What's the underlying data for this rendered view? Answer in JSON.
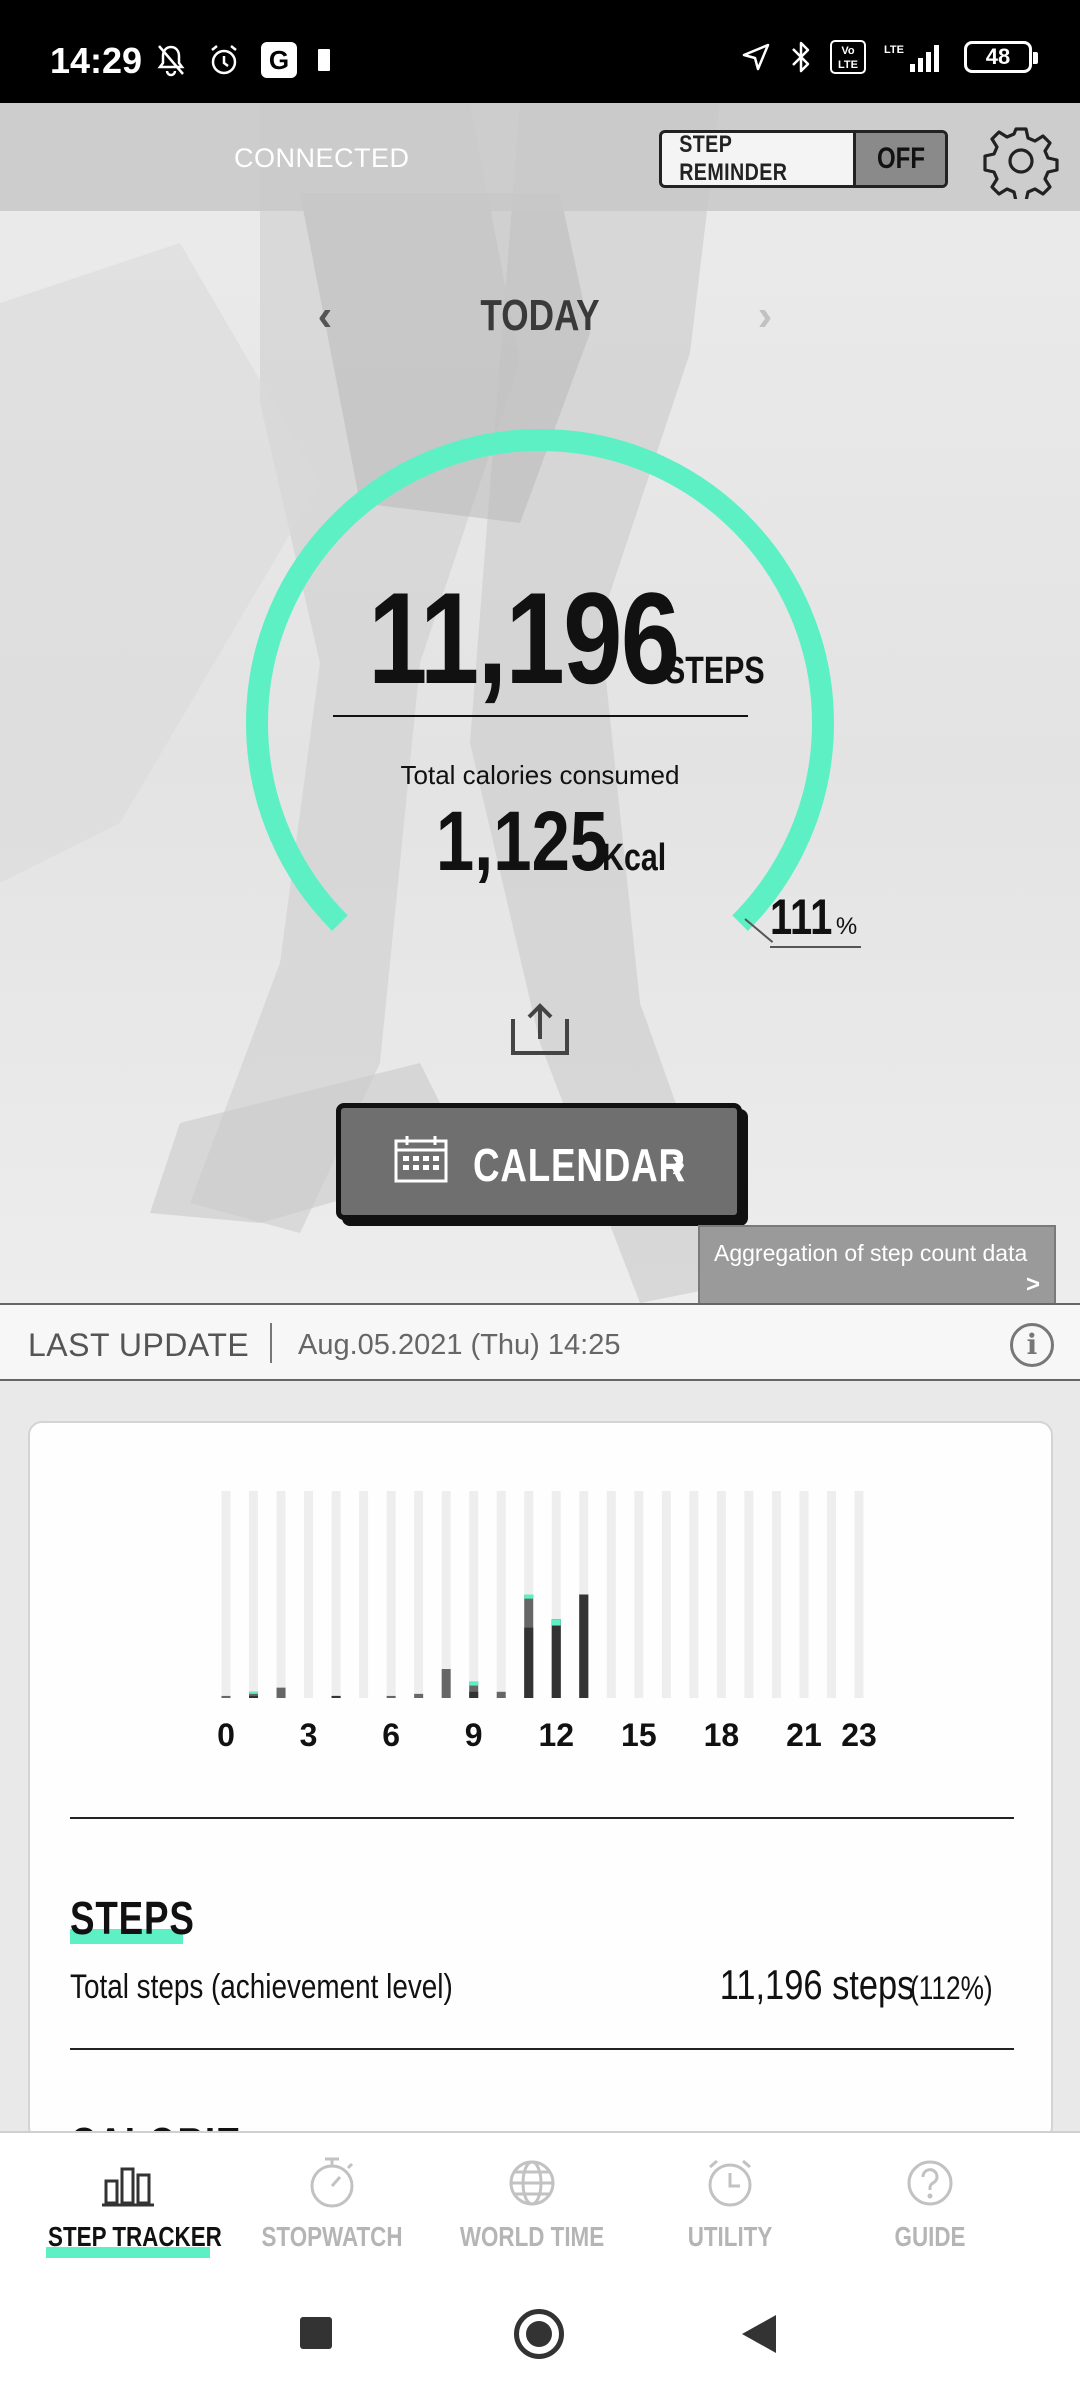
{
  "status_bar": {
    "time": "14:29",
    "icons_left": [
      "bell-off-icon",
      "alarm-icon",
      "g-app-icon",
      "notification-dot-icon"
    ],
    "icons_right": [
      "location-icon",
      "bluetooth-icon",
      "volte-icon",
      "lte-signal-icon",
      "battery-icon"
    ],
    "volte_label": "Vo LTE",
    "lte_label": "LTE",
    "battery": "48"
  },
  "header": {
    "connection_status": "CONNECTED",
    "step_reminder_label": "STEP REMINDER",
    "step_reminder_state": "OFF"
  },
  "day_nav": {
    "label": "TODAY",
    "prev": "‹",
    "next": "›"
  },
  "summary": {
    "steps_value": "11,196",
    "steps_unit": "STEPS",
    "calories_label": "Total calories consumed",
    "calories_value": "1,125",
    "calories_unit": "Kcal",
    "achievement_value": "111",
    "achievement_unit": "%",
    "achievement_fraction": 1.11
  },
  "calendar_button": {
    "label": "CALENDAR",
    "chevron": "›"
  },
  "tooltip": {
    "text": "Aggregation of step count data",
    "chevron": ">"
  },
  "last_update": {
    "label": "LAST UPDATE",
    "value": "Aug.05.2021 (Thu) 14:25"
  },
  "chart_data": {
    "type": "bar",
    "categories": [
      "0",
      "1",
      "2",
      "3",
      "4",
      "5",
      "6",
      "7",
      "8",
      "9",
      "10",
      "11",
      "12",
      "13",
      "14",
      "15",
      "16",
      "17",
      "18",
      "19",
      "20",
      "21",
      "22",
      "23"
    ],
    "tick_labels": [
      "0",
      "3",
      "6",
      "9",
      "12",
      "15",
      "18",
      "21",
      "23"
    ],
    "tick_positions": [
      0,
      3,
      6,
      9,
      12,
      15,
      18,
      21,
      23
    ],
    "series": [
      {
        "values": [
          0.01,
          0.03,
          0.05,
          0,
          0.01,
          0,
          0.01,
          0.02,
          0.14,
          0.08,
          0.03,
          0.5,
          0.38,
          0.5,
          0,
          0,
          0,
          0,
          0,
          0,
          0,
          0,
          0,
          0
        ]
      },
      {
        "values": [
          0,
          0.01,
          0,
          0,
          0.01,
          0,
          0,
          0,
          0,
          0.03,
          0,
          0.34,
          0.38,
          0.5,
          0,
          0,
          0,
          0,
          0,
          0,
          0,
          0,
          0,
          0
        ]
      },
      {
        "values": [
          0,
          0.01,
          0,
          0,
          0,
          0,
          0,
          0,
          0,
          0.02,
          0,
          0.02,
          0.03,
          0,
          0,
          0,
          0,
          0,
          0,
          0,
          0,
          0,
          0,
          0
        ]
      }
    ],
    "ylim": [
      0,
      1
    ],
    "grid": false,
    "colors": {
      "background_bar": "#eeeeee",
      "dark": "#333333",
      "mid": "#666666",
      "accent": "#5df0c4"
    }
  },
  "steps_section": {
    "heading": "STEPS",
    "total_label": "Total steps (achievement level)",
    "total_value": "11,196 steps",
    "total_pct": "(112%)"
  },
  "calorie_section": {
    "heading": "CALORIE"
  },
  "bottom_nav": {
    "items": [
      {
        "label": "STEP TRACKER",
        "icon": "bar-chart-icon",
        "active": true
      },
      {
        "label": "STOPWATCH",
        "icon": "stopwatch-icon",
        "active": false
      },
      {
        "label": "WORLD TIME",
        "icon": "globe-icon",
        "active": false
      },
      {
        "label": "UTILITY",
        "icon": "alarm-clock-icon",
        "active": false
      },
      {
        "label": "GUIDE",
        "icon": "help-icon",
        "active": false
      }
    ]
  },
  "colors": {
    "accent": "#5df0c4",
    "dark": "#111111",
    "button_gray": "#6f6f6f"
  }
}
